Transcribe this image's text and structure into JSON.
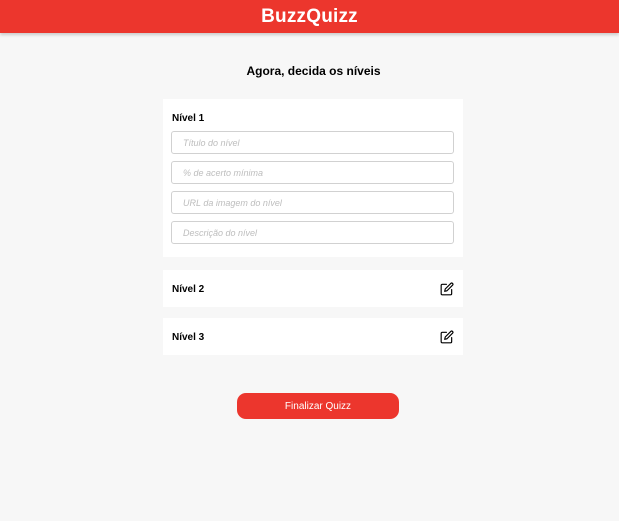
{
  "header": {
    "brand": "BuzzQuizz",
    "color": "#ec362d"
  },
  "page": {
    "title": "Agora, decida os níveis"
  },
  "levels": [
    {
      "title": "Nível 1",
      "expanded": true,
      "fields": {
        "title_placeholder": "Título do nível",
        "min_score_placeholder": "% de acerto mínima",
        "image_url_placeholder": "URL da imagem do nível",
        "description_placeholder": "Descrição do nível"
      }
    },
    {
      "title": "Nível 2",
      "expanded": false,
      "icon": "edit-icon"
    },
    {
      "title": "Nível 3",
      "expanded": false,
      "icon": "edit-icon"
    }
  ],
  "actions": {
    "finish_label": "Finalizar Quizz"
  }
}
